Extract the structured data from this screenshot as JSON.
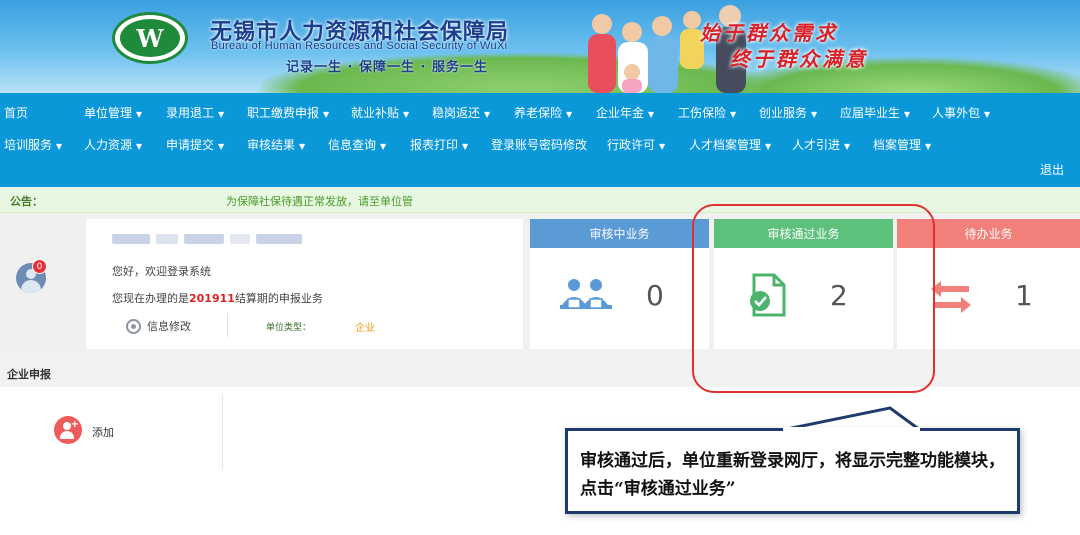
{
  "header": {
    "org_name_cn": "无锡市人力资源和社会保障局",
    "org_name_en": "Bureau of Human Resources and Social Security of WuXi",
    "slogan": "记录一生 · 保障一生 · 服务一生",
    "motto_line1": "始于群众需求",
    "motto_line2": "终于群众满意",
    "logo_icon": "wuxi-hrss-logo"
  },
  "nav": {
    "row1": [
      {
        "label": "首页",
        "has_menu": false
      },
      {
        "label": "单位管理",
        "has_menu": true
      },
      {
        "label": "录用退工",
        "has_menu": true
      },
      {
        "label": "职工缴费申报",
        "has_menu": true
      },
      {
        "label": "就业补贴",
        "has_menu": true
      },
      {
        "label": "稳岗返还",
        "has_menu": true
      },
      {
        "label": "养老保险",
        "has_menu": true
      },
      {
        "label": "企业年金",
        "has_menu": true
      },
      {
        "label": "工伤保险",
        "has_menu": true
      },
      {
        "label": "创业服务",
        "has_menu": true
      },
      {
        "label": "应届毕业生",
        "has_menu": true
      },
      {
        "label": "人事外包",
        "has_menu": true
      }
    ],
    "row2": [
      {
        "label": "培训服务",
        "has_menu": true
      },
      {
        "label": "人力资源",
        "has_menu": true
      },
      {
        "label": "申请提交",
        "has_menu": true
      },
      {
        "label": "审核结果",
        "has_menu": true
      },
      {
        "label": "信息查询",
        "has_menu": true
      },
      {
        "label": "报表打印",
        "has_menu": true
      },
      {
        "label": "登录账号密码修改",
        "has_menu": false
      },
      {
        "label": "行政许可",
        "has_menu": true
      },
      {
        "label": "人才档案管理",
        "has_menu": true
      },
      {
        "label": "人才引进",
        "has_menu": true
      },
      {
        "label": "档案管理",
        "has_menu": true
      }
    ],
    "caret": "▼",
    "logout": "退出"
  },
  "notice": {
    "label": "公告：",
    "text": "为保障社保待遇正常发放，请至单位管"
  },
  "profile": {
    "badge_count": "0",
    "greeting": "您好，欢迎登录系统",
    "period_prefix": "您现在办理的是",
    "period_value": "201911",
    "period_suffix": "结算期的申报业务",
    "info_edit_label": "信息修改",
    "unit_type_label": "单位类型：",
    "unit_type_value": "企业"
  },
  "stats": [
    {
      "title": "审核中业务",
      "count": "0",
      "icon": "users-at-desk-icon",
      "color": "#5b9bd5"
    },
    {
      "title": "审核通过业务",
      "count": "2",
      "icon": "document-check-icon",
      "color": "#5dc17c"
    },
    {
      "title": "待办业务",
      "count": "1",
      "icon": "exchange-arrows-icon",
      "color": "#f08079"
    }
  ],
  "enterprise": {
    "section_title": "企业申报",
    "add_label": "添加"
  },
  "annotation": {
    "text": "审核通过后，单位重新登录网厅，将显示完整功能模块，点击“审核通过业务”"
  }
}
